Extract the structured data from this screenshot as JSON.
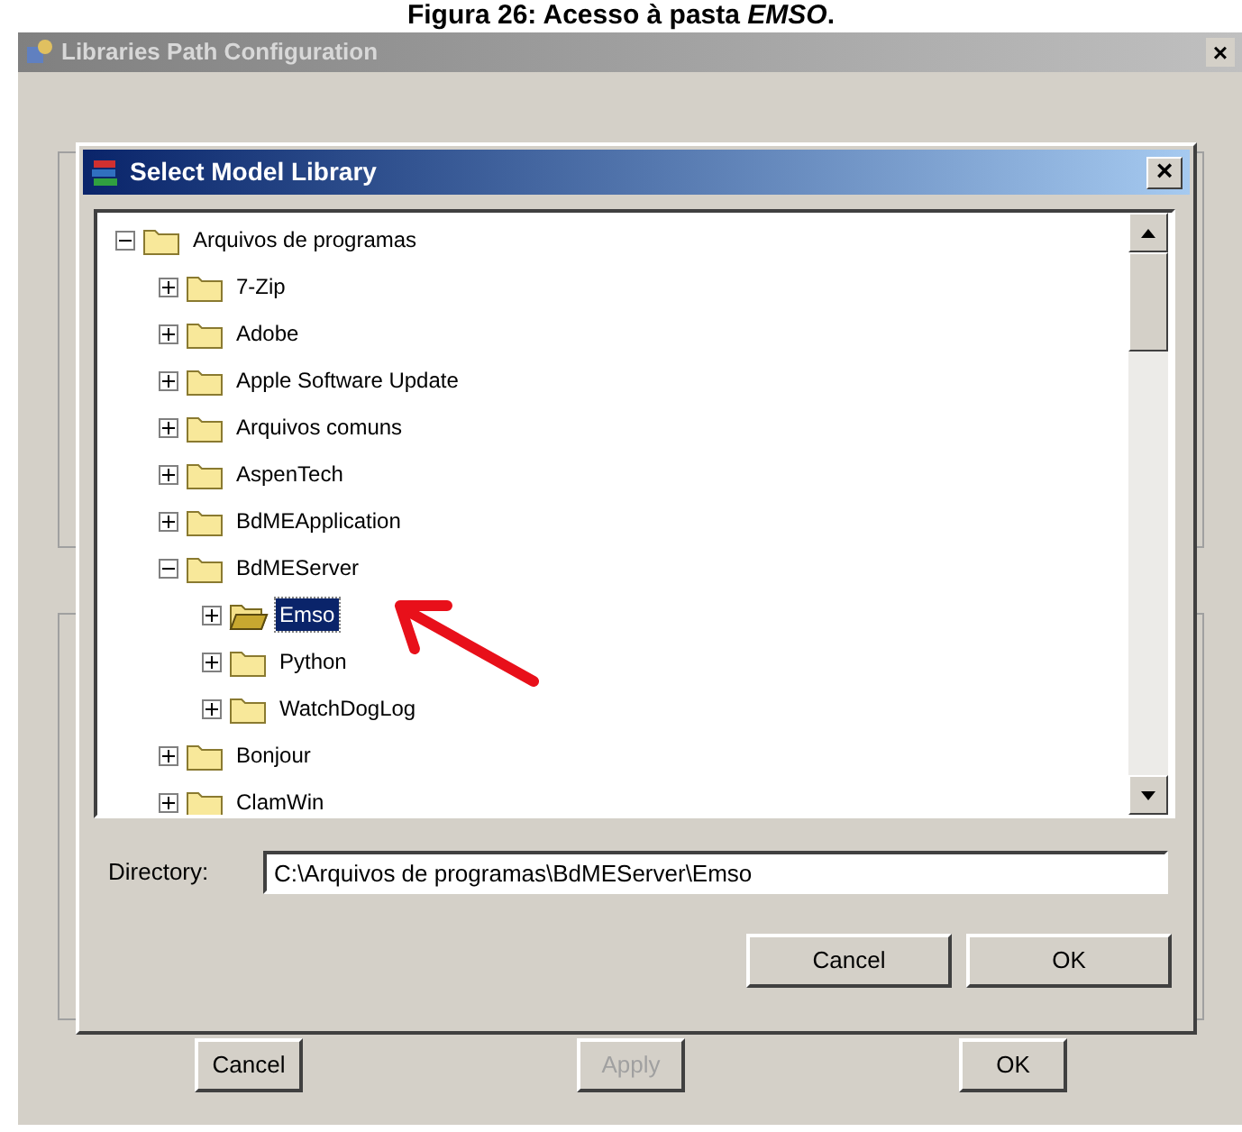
{
  "caption": "Figura 26: Acesso à pasta *EMSO*.",
  "window": {
    "title": "Libraries Path Configuration",
    "close": "×"
  },
  "dialog": {
    "title": "Select Model Library",
    "close": "×",
    "tree": [
      {
        "label": "Arquivos de programas",
        "expanded": true,
        "selected": false,
        "children": [
          {
            "label": "7-Zip",
            "expanded": false,
            "selected": false
          },
          {
            "label": "Adobe",
            "expanded": false,
            "selected": false
          },
          {
            "label": "Apple Software Update",
            "expanded": false,
            "selected": false
          },
          {
            "label": "Arquivos comuns",
            "expanded": false,
            "selected": false
          },
          {
            "label": "AspenTech",
            "expanded": false,
            "selected": false
          },
          {
            "label": "BdMEApplication",
            "expanded": false,
            "selected": false
          },
          {
            "label": "BdMEServer",
            "expanded": true,
            "selected": false,
            "children": [
              {
                "label": "Emso",
                "expanded": false,
                "selected": true
              },
              {
                "label": "Python",
                "expanded": false,
                "selected": false
              },
              {
                "label": "WatchDogLog",
                "expanded": false,
                "selected": false
              }
            ]
          },
          {
            "label": "Bonjour",
            "expanded": false,
            "selected": false
          },
          {
            "label": "ClamWin",
            "expanded": false,
            "selected": false
          }
        ]
      }
    ],
    "directory": {
      "label": "Directory:",
      "value": "C:\\Arquivos de programas\\BdMEServer\\Emso"
    },
    "buttons": [
      {
        "label": "Cancel"
      },
      {
        "label": "OK"
      }
    ]
  },
  "buttons": [
    {
      "label": "Cancel",
      "disabled": false
    },
    {
      "label": "Apply",
      "disabled": true
    },
    {
      "label": "OK",
      "disabled": false
    }
  ]
}
